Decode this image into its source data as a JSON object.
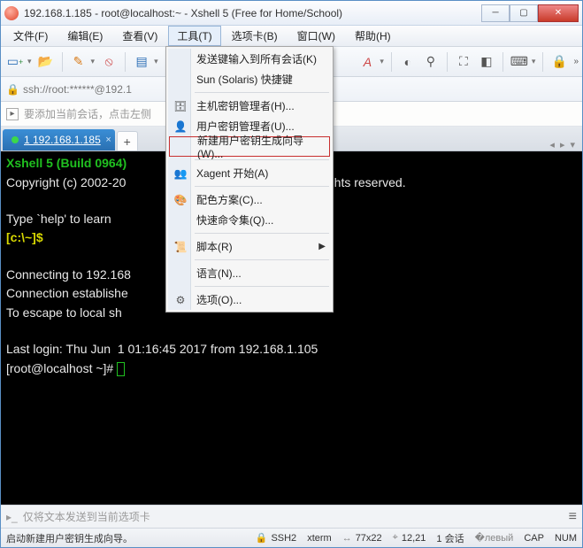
{
  "window": {
    "title": "192.168.1.185 - root@localhost:~ - Xshell 5 (Free for Home/School)"
  },
  "menubar": {
    "items": [
      {
        "label": "文件(F)"
      },
      {
        "label": "编辑(E)"
      },
      {
        "label": "查看(V)"
      },
      {
        "label": "工具(T)",
        "open": true
      },
      {
        "label": "选项卡(B)"
      },
      {
        "label": "窗口(W)"
      },
      {
        "label": "帮助(H)"
      }
    ]
  },
  "addressbar": {
    "url": "ssh://root:******@192.1"
  },
  "hintbar": {
    "text": "要添加当前会话，点击左侧"
  },
  "tabs": {
    "items": [
      {
        "label": "1 192.168.1.185",
        "active": true
      }
    ]
  },
  "dropdown": {
    "items": [
      {
        "label": "发送键输入到所有会话(K)"
      },
      {
        "label": "Sun (Solaris) 快捷键"
      },
      {
        "sep": true
      },
      {
        "label": "主机密钥管理者(H)...",
        "icon": "host-key"
      },
      {
        "label": "用户密钥管理者(U)...",
        "icon": "user-key"
      },
      {
        "label": "新建用户密钥生成向导(W)...",
        "highlight": true
      },
      {
        "sep": true
      },
      {
        "label": "Xagent 开始(A)",
        "icon": "xagent"
      },
      {
        "sep": true
      },
      {
        "label": "配色方案(C)...",
        "icon": "palette"
      },
      {
        "label": "快速命令集(Q)..."
      },
      {
        "sep": true
      },
      {
        "label": "脚本(R)",
        "submenu": true,
        "icon": "script"
      },
      {
        "sep": true
      },
      {
        "label": "语言(N)..."
      },
      {
        "sep": true
      },
      {
        "label": "选项(O)...",
        "icon": "gear"
      }
    ]
  },
  "terminal": {
    "l1a": "Xshell 5 (Build 0964)",
    "l2a": "Copyright (c) 2002-20",
    "l2b": ". All rights reserved.",
    "l3": "Type `help' to learn ",
    "prompt1a": "[c:\\~]$",
    "l5": "Connecting to 192.168",
    "l6": "Connection establishe",
    "l7": "To escape to local sh",
    "l8": "Last login: Thu Jun  1 01:16:45 2017 from 192.168.1.105",
    "l9": "[root@localhost ~]# "
  },
  "sendbar": {
    "placeholder": "仅将文本发送到当前选项卡"
  },
  "statusbar": {
    "hint": "启动新建用户密钥生成向导。",
    "ssh": "SSH2",
    "term": "xterm",
    "size": "77x22",
    "pos": "12,21",
    "sessions": "1 会话",
    "cap": "CAP",
    "num": "NUM"
  }
}
